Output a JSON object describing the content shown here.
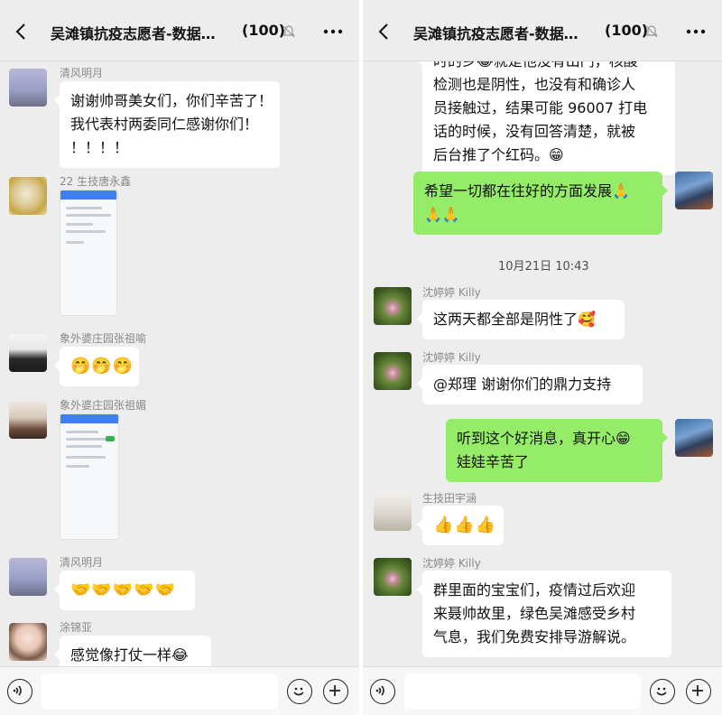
{
  "left": {
    "header": {
      "title": "吴滩镇抗疫志愿者-数据…",
      "count": "(100)"
    },
    "messages": [
      {
        "sender": "清风明月",
        "lines": [
          "谢谢帅哥美女们，你们辛苦了！",
          "我代表村两委同仁感谢你们！",
          "！！！！"
        ]
      },
      {
        "sender": "22 生技唐永鑫",
        "type": "image"
      },
      {
        "sender": "象外婆庄园张祖喻",
        "emoji": "🤭🤭🤭"
      },
      {
        "sender": "象外婆庄园张祖媚",
        "type": "image"
      },
      {
        "sender": "清风明月",
        "emoji": "🤝🤝🤝🤝🤝"
      },
      {
        "sender": "涂锦亚",
        "text": "感觉像打仗一样😂"
      }
    ]
  },
  "right": {
    "header": {
      "title": "吴滩镇抗疫志愿者-数据…",
      "count": "(100)"
    },
    "messages": [
      {
        "sender": "",
        "lines": [
          "时的乡😂就是他没有出门，核酸",
          "检测也是阴性，也没有和确诊人",
          "员接触过，结果可能 96007 打电",
          "话的时候，没有回答清楚，就被",
          "后台推了个红码。😁"
        ]
      },
      {
        "sender": "me",
        "lines": [
          "希望一切都在往好的方面发展🙏",
          "🙏🙏"
        ]
      },
      {
        "timestamp": "10月21日 10:43"
      },
      {
        "sender": "沈婷婷 Killy",
        "text": "这两天都全部是阴性了🥰"
      },
      {
        "sender": "沈婷婷 Killy",
        "text": "@郑理 谢谢你们的鼎力支持"
      },
      {
        "sender": "me",
        "lines": [
          "听到这个好消息，真开心😁",
          "娃娃辛苦了"
        ]
      },
      {
        "sender": "生技田宇涵",
        "emoji": "👍👍👍"
      },
      {
        "sender": "沈婷婷 Killy",
        "lines": [
          "群里面的宝宝们，疫情过后欢迎",
          "来聂帅故里，绿色吴滩感受乡村",
          "气息，我们免费安排导游解说。"
        ]
      }
    ]
  },
  "colors": {
    "my_bubble": "#95ec69",
    "background": "#ededed",
    "bubble": "#ffffff"
  },
  "icons": [
    "back-arrow-icon",
    "bell-mute-icon",
    "more-dots-icon",
    "voice-icon",
    "emoji-icon",
    "plus-icon"
  ]
}
